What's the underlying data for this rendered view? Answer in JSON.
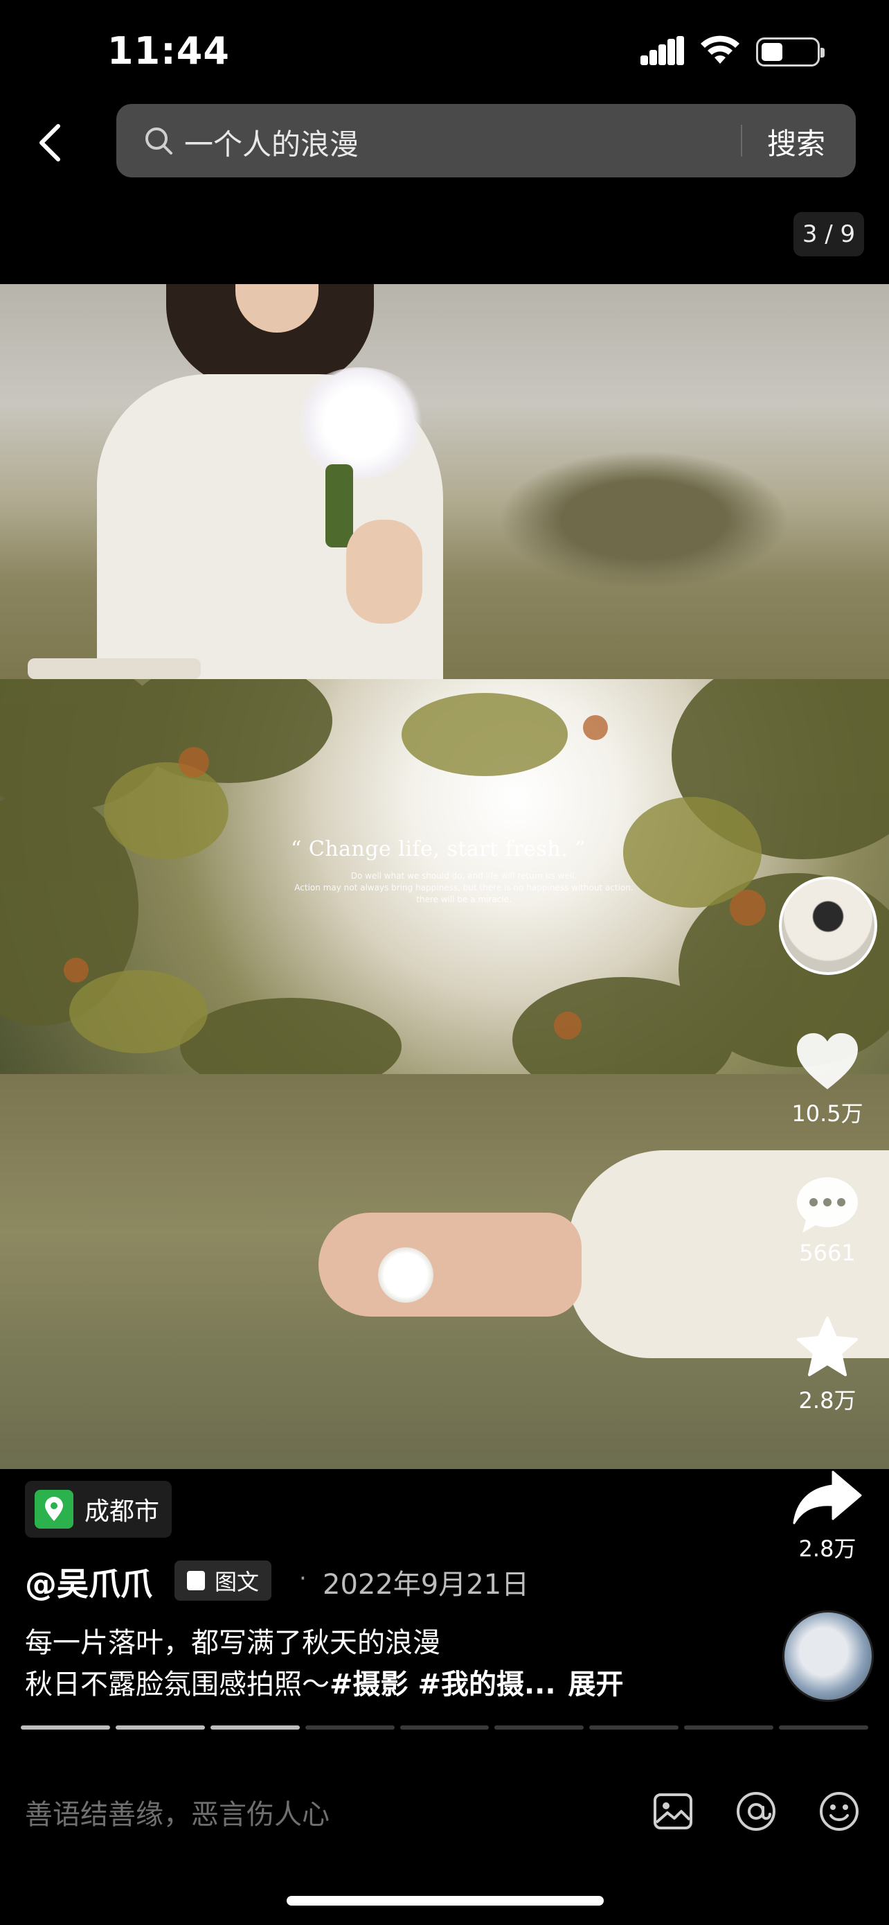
{
  "status_bar": {
    "time": "11:44"
  },
  "header": {
    "search_query": "一个人的浪漫",
    "search_button": "搜索",
    "page_counter": "3 / 9"
  },
  "photo": {
    "quote_title": "“ Change life, start fresh. ”",
    "quote_lines": [
      "Do well what we should do, and life will return us well.",
      "Action may not always bring happiness, but there is no happiness without action.",
      "there will be a miracle."
    ]
  },
  "actions": {
    "likes": "10.5万",
    "comments": "5661",
    "favorites": "2.8万",
    "shares": "2.8万"
  },
  "post": {
    "location": "成都市",
    "username": "@吴爪爪",
    "type_badge": "图文",
    "separator": "·",
    "date": "2022年9月21日",
    "caption_line1": "每一片落叶，都写满了秋天的浪漫",
    "caption_line2_text": "秋日不露脸氛围感拍照～",
    "caption_line2_tags": "#摄影 #我的摄...",
    "expand": "展开"
  },
  "progress": {
    "total": 9,
    "current": 3
  },
  "comment_bar": {
    "placeholder": "善语结善缘，恶言伤人心"
  }
}
